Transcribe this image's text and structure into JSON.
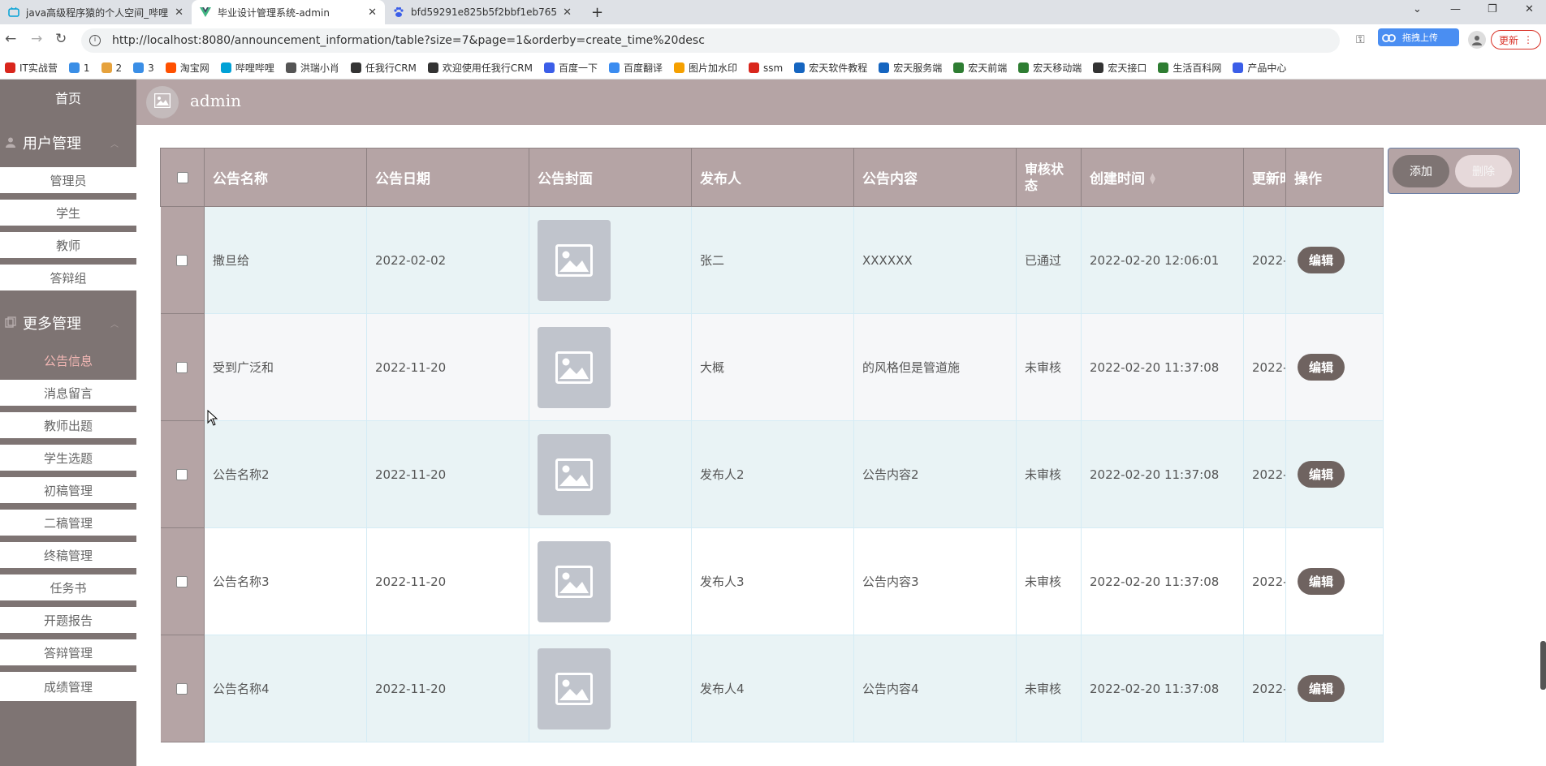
{
  "browser": {
    "tabs": [
      {
        "title": "java高级程序猿的个人空间_哔哩",
        "favicon": "bilibili-icon",
        "color": "#00a1d6"
      },
      {
        "title": "毕业设计管理系统-admin",
        "favicon": "vue-icon",
        "color": "#41b883"
      },
      {
        "title": "bfd59291e825b5f2bbf1eb765",
        "favicon": "baidu-icon",
        "color": "#3b5ee8"
      }
    ],
    "new_tab": "+",
    "close": "✕",
    "url": "http://localhost:8080/announcement_information/table?size=7&page=1&orderby=create_time%20desc",
    "ext_upload": "拖拽上传",
    "update_label": "更新",
    "bookmarks": [
      {
        "label": "IT实战营",
        "color": "#d9261c"
      },
      {
        "label": "1",
        "color": "#3a8ee6"
      },
      {
        "label": "2",
        "color": "#e6a23c"
      },
      {
        "label": "3",
        "color": "#3a8ee6"
      },
      {
        "label": "淘宝网",
        "color": "#ff5000"
      },
      {
        "label": "哔哩哔哩",
        "color": "#00a1d6"
      },
      {
        "label": "洪瑞小肖",
        "color": "#555555"
      },
      {
        "label": "任我行CRM",
        "color": "#333333"
      },
      {
        "label": "欢迎使用任我行CRM",
        "color": "#333333"
      },
      {
        "label": "百度一下",
        "color": "#3b5ee8"
      },
      {
        "label": "百度翻译",
        "color": "#3b8cf0"
      },
      {
        "label": "图片加水印",
        "color": "#f5a000"
      },
      {
        "label": "ssm",
        "color": "#d9261c"
      },
      {
        "label": "宏天软件教程",
        "color": "#1565c0"
      },
      {
        "label": "宏天服务端",
        "color": "#1565c0"
      },
      {
        "label": "宏天前端",
        "color": "#2e7d32"
      },
      {
        "label": "宏天移动端",
        "color": "#2e7d32"
      },
      {
        "label": "宏天接口",
        "color": "#333333"
      },
      {
        "label": "生活百科网",
        "color": "#2e7d32"
      },
      {
        "label": "产品中心",
        "color": "#3b5ee8"
      }
    ]
  },
  "sidebar": {
    "home": "首页",
    "groups": [
      {
        "title": "用户管理",
        "icon": "user-icon",
        "items": [
          "管理员",
          "学生",
          "教师",
          "答辩组"
        ]
      },
      {
        "title": "更多管理",
        "icon": "copy-icon",
        "items": [
          "公告信息",
          "消息留言",
          "教师出题",
          "学生选题",
          "初稿管理",
          "二稿管理",
          "终稿管理",
          "任务书",
          "开题报告",
          "答辩管理",
          "成绩管理"
        ]
      }
    ],
    "active": "公告信息"
  },
  "header": {
    "username": "admin"
  },
  "table": {
    "columns": [
      "公告名称",
      "公告日期",
      "公告封面",
      "发布人",
      "公告内容",
      "审核状\n态",
      "创建时间",
      "更新时",
      "操作"
    ],
    "rows": [
      {
        "name": "撒旦给",
        "date": "2022-02-02",
        "publisher": "张二",
        "content": "XXXXXX",
        "status": "已通过",
        "created": "2022-02-20 12:06:01",
        "updated": "2022-"
      },
      {
        "name": "受到广泛和",
        "date": "2022-11-20",
        "publisher": "大概",
        "content": "的风格但是管道施",
        "status": "未审核",
        "created": "2022-02-20 11:37:08",
        "updated": "2022-"
      },
      {
        "name": "公告名称2",
        "date": "2022-11-20",
        "publisher": "发布人2",
        "content": "公告内容2",
        "status": "未审核",
        "created": "2022-02-20 11:37:08",
        "updated": "2022-"
      },
      {
        "name": "公告名称3",
        "date": "2022-11-20",
        "publisher": "发布人3",
        "content": "公告内容3",
        "status": "未审核",
        "created": "2022-02-20 11:37:08",
        "updated": "2022-"
      },
      {
        "name": "公告名称4",
        "date": "2022-11-20",
        "publisher": "发布人4",
        "content": "公告内容4",
        "status": "未审核",
        "created": "2022-02-20 11:37:08",
        "updated": "2022-"
      }
    ],
    "edit_label": "编辑"
  },
  "actions": {
    "add": "添加",
    "delete": "删除"
  }
}
